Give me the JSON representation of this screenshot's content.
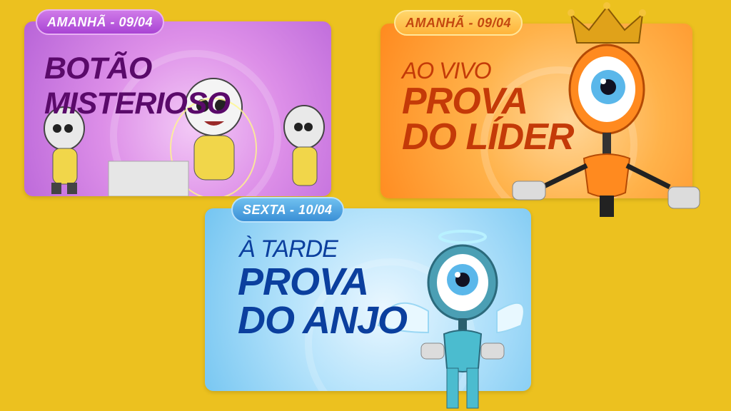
{
  "cards": [
    {
      "badge": "AMANHÃ - 09/04",
      "lines": [
        "BOTÃO MISTERIOSO"
      ]
    },
    {
      "badge": "AMANHÃ - 09/04",
      "small": "AO VIVO",
      "lines": [
        "PROVA",
        "DO LÍDER"
      ]
    },
    {
      "badge": "SEXTA - 10/04",
      "small": "À TARDE",
      "lines": [
        "PROVA",
        "DO ANJO"
      ]
    }
  ],
  "colors": {
    "background": "#ecc11f",
    "purple_text": "#5a0a6a",
    "orange_text": "#c43a08",
    "blue_text": "#0b3f9e"
  },
  "icons": [
    "robot-dummy",
    "crowned-eye-robot",
    "angel-eye-robot"
  ]
}
